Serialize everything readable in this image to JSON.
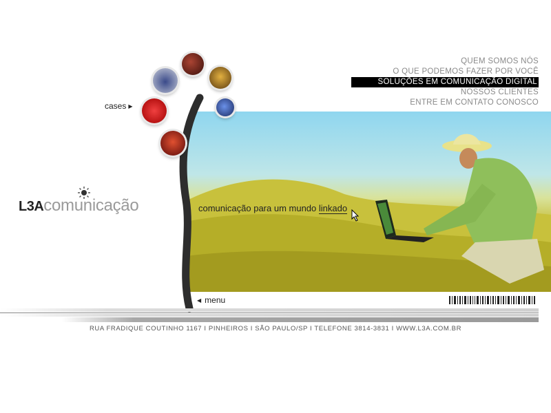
{
  "nav": {
    "items": [
      {
        "label": "QUEM SOMOS NÓS",
        "active": false
      },
      {
        "label": "O QUE PODEMOS FAZER POR VOCÊ",
        "active": false
      },
      {
        "label": "SOLUÇÕES EM COMUNICAÇÃO DIGITAL",
        "active": true
      },
      {
        "label": "NOSSOS CLIENTES",
        "active": false
      },
      {
        "label": "ENTRE EM CONTATO CONOSCO",
        "active": false
      }
    ]
  },
  "cases": {
    "label": "cases"
  },
  "logo": {
    "l3a": "L3A",
    "comunicacao": "comunicação"
  },
  "tagline": {
    "text": "comunicação para um mundo ",
    "link": "linkado"
  },
  "menu": {
    "label": "menu"
  },
  "footer": {
    "text": "RUA FRADIQUE COUTINHO 1167  I  PINHEIROS  I  SÃO PAULO/SP  I  TELEFONE 3814-3831  I  WWW.L3A.COM.BR"
  },
  "colors": {
    "nav_active_bg": "#000000",
    "nav_text": "#8a8a8a",
    "logo_gray": "#9a9a9a"
  }
}
